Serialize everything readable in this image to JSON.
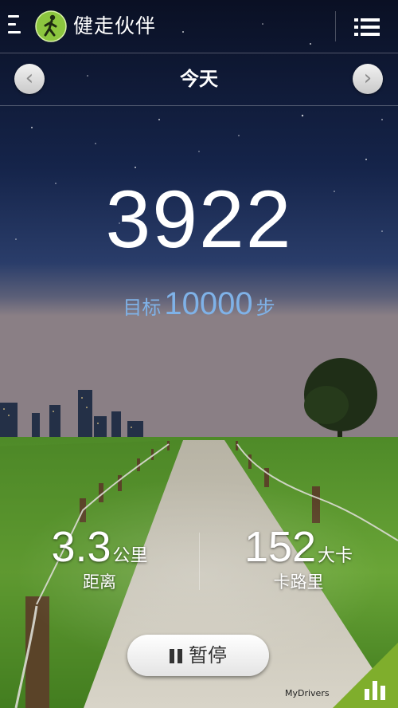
{
  "app": {
    "title": "健走伙伴"
  },
  "header": {
    "date_label": "今天",
    "prev_icon": "chevron-left-icon",
    "next_icon": "chevron-right-icon"
  },
  "steps": {
    "count": "3922",
    "goal_label": "目标",
    "goal_value": "10000",
    "goal_unit": "步"
  },
  "distance": {
    "value": "3.3",
    "unit": "公里",
    "label": "距离"
  },
  "calories": {
    "value": "152",
    "unit": "大卡",
    "label": "卡路里"
  },
  "control": {
    "pause_label": "暂停"
  },
  "watermark": {
    "text": "MyDrivers"
  },
  "colors": {
    "goal": "#7fb2e8",
    "accent": "#8cc63f",
    "sky_top": "#0b1226",
    "grass": "#5c9a2e"
  }
}
